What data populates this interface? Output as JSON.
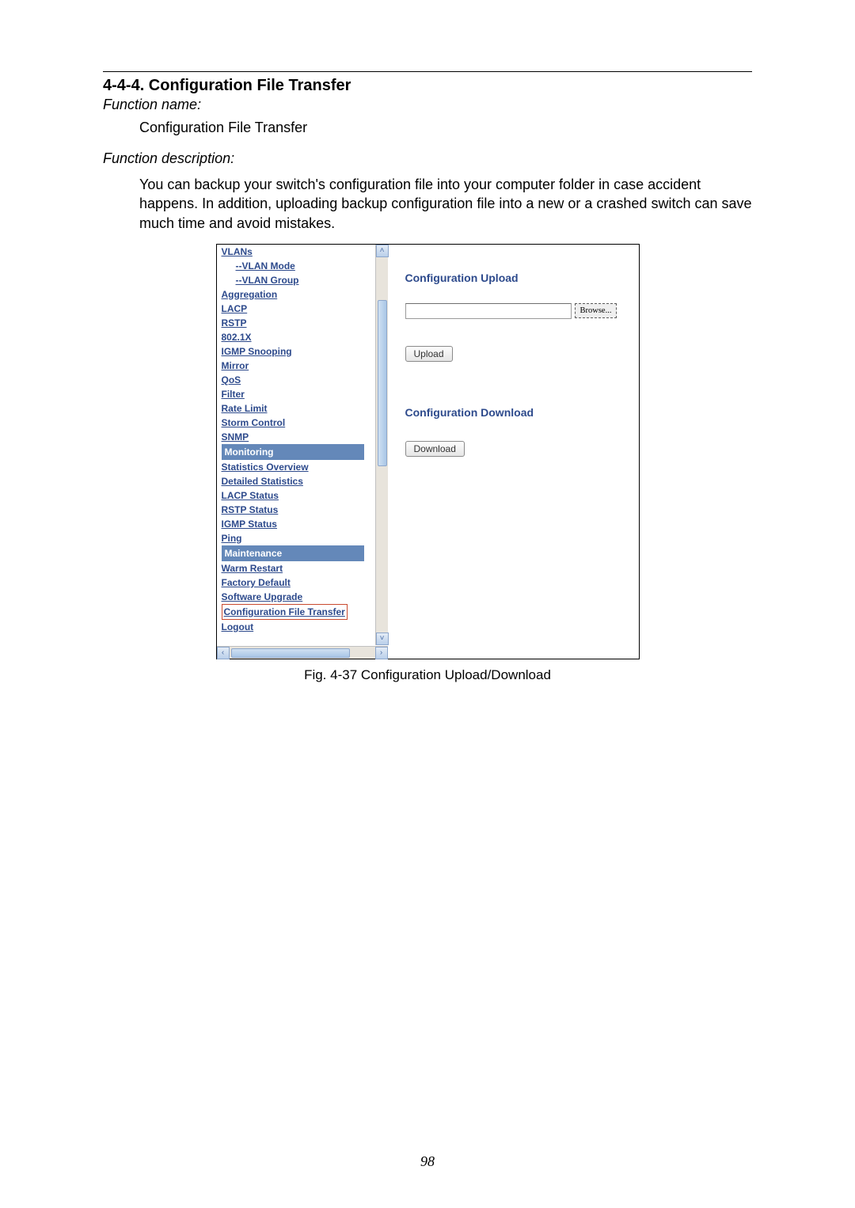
{
  "doc": {
    "section_number_title": "4-4-4. Configuration File Transfer",
    "function_name_label": "Function name:",
    "function_name_value": "Configuration File Transfer",
    "function_desc_label": "Function description:",
    "function_desc_value": "You can backup your switch's configuration file into your computer folder in case accident happens. In addition, uploading backup configuration file into a new or a crashed switch can save much time and avoid mistakes.",
    "fig_caption": "Fig. 4-37 Configuration Upload/Download",
    "page_number": "98"
  },
  "sidebar": {
    "items": [
      {
        "type": "item",
        "label": "VLANs"
      },
      {
        "type": "sub",
        "label": "--VLAN Mode"
      },
      {
        "type": "sub",
        "label": "--VLAN Group"
      },
      {
        "type": "item",
        "label": "Aggregation"
      },
      {
        "type": "item",
        "label": "LACP"
      },
      {
        "type": "item",
        "label": "RSTP"
      },
      {
        "type": "item",
        "label": "802.1X"
      },
      {
        "type": "item",
        "label": "IGMP Snooping"
      },
      {
        "type": "item",
        "label": "Mirror"
      },
      {
        "type": "item",
        "label": "QoS"
      },
      {
        "type": "item",
        "label": "Filter"
      },
      {
        "type": "item",
        "label": "Rate Limit"
      },
      {
        "type": "item",
        "label": "Storm Control"
      },
      {
        "type": "item",
        "label": "SNMP"
      },
      {
        "type": "header",
        "label": "Monitoring"
      },
      {
        "type": "item",
        "label": "Statistics Overview"
      },
      {
        "type": "item",
        "label": "Detailed Statistics"
      },
      {
        "type": "item",
        "label": "LACP Status"
      },
      {
        "type": "item",
        "label": "RSTP Status"
      },
      {
        "type": "item",
        "label": "IGMP Status"
      },
      {
        "type": "item",
        "label": "Ping"
      },
      {
        "type": "header",
        "label": "Maintenance"
      },
      {
        "type": "item",
        "label": "Warm Restart"
      },
      {
        "type": "item",
        "label": "Factory Default"
      },
      {
        "type": "item",
        "label": "Software Upgrade"
      },
      {
        "type": "selected",
        "label": "Configuration File Transfer"
      },
      {
        "type": "item",
        "label": "Logout"
      }
    ]
  },
  "main": {
    "upload_title": "Configuration Upload",
    "file_value": "",
    "browse_label": "Browse...",
    "upload_label": "Upload",
    "download_title": "Configuration Download",
    "download_label": "Download"
  }
}
